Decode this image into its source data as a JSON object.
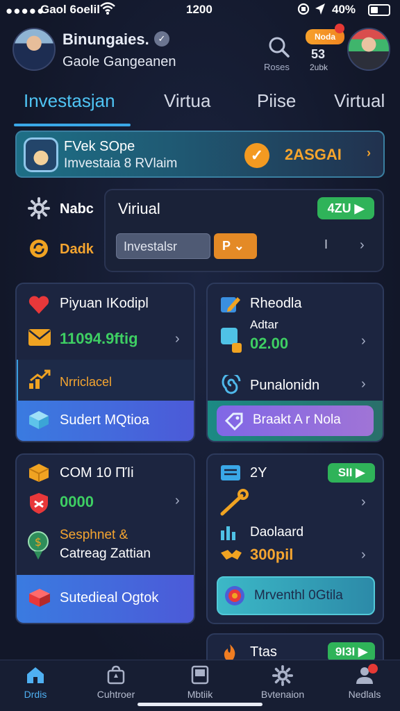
{
  "status_bar": {
    "signal": "●●●●●",
    "carrier": "Gaol 6oelil",
    "time": "1200",
    "battery": "40%"
  },
  "header": {
    "name": "Binungaies.",
    "subtitle": "Gaole Gangeanen",
    "search_label": "Roses",
    "badge": "Noda",
    "stat_value": "53",
    "stat_label": "2ubk"
  },
  "tabs": [
    "Investasjan",
    "Virtua",
    "Piise",
    "Virtual"
  ],
  "promo": {
    "title": "FVek SOpe",
    "subtitle": "Imvestaia 8 RVlaim",
    "amount": "2ASGAI",
    "chevron": "›"
  },
  "side": {
    "item1": "Nabc",
    "item2": "Dadk"
  },
  "virtual_panel": {
    "title": "Viriual",
    "green_button": "4ZU ▶",
    "input_value": "Investalsr",
    "select_value": "P",
    "cursor": "I"
  },
  "card_l1": {
    "row1": "Piyuan IKodipl",
    "row2_value": "11094.9ftig",
    "row3": "Nrriclacel",
    "footer": "Sudert MQtioa"
  },
  "card_r1": {
    "row1": "Rheodla",
    "row2_label": "Adtar",
    "row2_value": "02.00",
    "row3": "Punalonidn",
    "footer": "Braakt A r Nola"
  },
  "card_l2": {
    "row1": "COM 10 ΠΊi",
    "row2_value": "0000",
    "row3_line1": "Sesphnet &",
    "row3_line2": "Catreag Zattian",
    "footer": "Sutedieal Ogtok"
  },
  "card_r2": {
    "row1": "2Y",
    "row1_button": "SII ▶",
    "row3_label": "Daolaard",
    "row3_value": "300pil",
    "footer": "Mrventhl 0Gtila"
  },
  "card_r3": {
    "row1": "Ttas",
    "button": "9I3I ▶"
  },
  "bottom_nav": [
    {
      "label": "Drdis",
      "icon": "⌂"
    },
    {
      "label": "Cuhtroer",
      "icon": "⛉"
    },
    {
      "label": "Mbtiik",
      "icon": "▣"
    },
    {
      "label": "Bvtenaion",
      "icon": "⚙"
    },
    {
      "label": "Nedlals",
      "icon": "👤"
    }
  ]
}
